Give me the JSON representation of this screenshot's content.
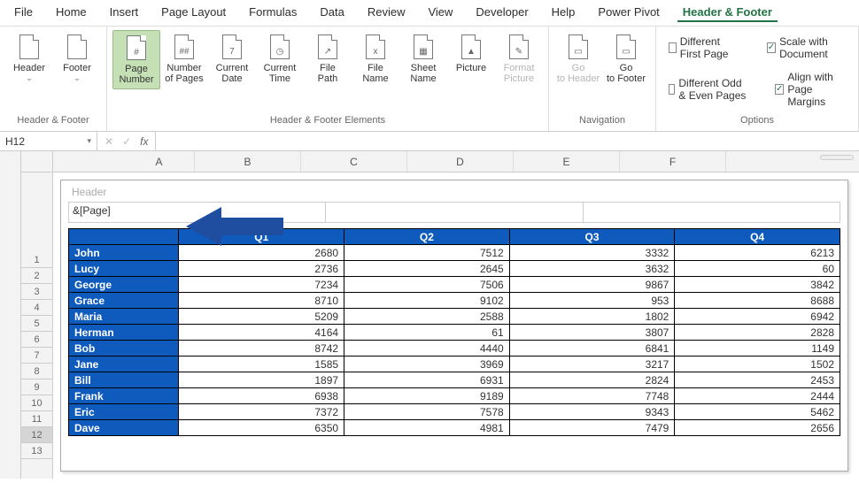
{
  "tabs": [
    "File",
    "Home",
    "Insert",
    "Page Layout",
    "Formulas",
    "Data",
    "Review",
    "View",
    "Developer",
    "Help",
    "Power Pivot",
    "Header & Footer"
  ],
  "active_tab_index": 11,
  "groups": {
    "hf": {
      "label": "Header & Footer",
      "buttons": [
        {
          "label": "Header",
          "caret": true,
          "glyph": ""
        },
        {
          "label": "Footer",
          "caret": true,
          "glyph": ""
        }
      ]
    },
    "elements": {
      "label": "Header & Footer Elements",
      "buttons": [
        {
          "label": "Page Number",
          "glyph": "#",
          "sel": true
        },
        {
          "label": "Number of Pages",
          "glyph": "##"
        },
        {
          "label": "Current Date",
          "glyph": "7"
        },
        {
          "label": "Current Time",
          "glyph": "◷"
        },
        {
          "label": "File Path",
          "glyph": "↗"
        },
        {
          "label": "File Name",
          "glyph": "x"
        },
        {
          "label": "Sheet Name",
          "glyph": "▦"
        },
        {
          "label": "Picture",
          "glyph": "▲"
        },
        {
          "label": "Format Picture",
          "glyph": "✎",
          "disabled": true
        }
      ]
    },
    "nav": {
      "label": "Navigation",
      "buttons": [
        {
          "label": "Go to Header",
          "glyph": "▭",
          "disabled": true
        },
        {
          "label": "Go to Footer",
          "glyph": "▭"
        }
      ]
    }
  },
  "options": {
    "label": "Options",
    "items": [
      {
        "label": "Different First Page",
        "checked": false
      },
      {
        "label": "Scale with Document",
        "checked": true
      },
      {
        "label": "Different Odd & Even Pages",
        "checked": false
      },
      {
        "label": "Align with Page Margins",
        "checked": true
      }
    ]
  },
  "cell_ref": "H12",
  "fx": "fx",
  "header_label": "Header",
  "header_value": "&[Page]",
  "columns": [
    "A",
    "B",
    "C",
    "D",
    "E",
    "F"
  ],
  "rows": [
    1,
    2,
    3,
    4,
    5,
    6,
    7,
    8,
    9,
    10,
    11,
    12,
    13
  ],
  "selected_row": 12,
  "chart_data": {
    "type": "table",
    "headers": [
      "",
      "Q1",
      "Q2",
      "Q3",
      "Q4"
    ],
    "data": [
      {
        "name": "John",
        "Q1": 2680,
        "Q2": 7512,
        "Q3": 3332,
        "Q4": 6213
      },
      {
        "name": "Lucy",
        "Q1": 2736,
        "Q2": 2645,
        "Q3": 3632,
        "Q4": 60
      },
      {
        "name": "George",
        "Q1": 7234,
        "Q2": 7506,
        "Q3": 9867,
        "Q4": 3842
      },
      {
        "name": "Grace",
        "Q1": 8710,
        "Q2": 9102,
        "Q3": 953,
        "Q4": 8688
      },
      {
        "name": "Maria",
        "Q1": 5209,
        "Q2": 2588,
        "Q3": 1802,
        "Q4": 6942
      },
      {
        "name": "Herman",
        "Q1": 4164,
        "Q2": 61,
        "Q3": 3807,
        "Q4": 2828
      },
      {
        "name": "Bob",
        "Q1": 8742,
        "Q2": 4440,
        "Q3": 6841,
        "Q4": 1149
      },
      {
        "name": "Jane",
        "Q1": 1585,
        "Q2": 3969,
        "Q3": 3217,
        "Q4": 1502
      },
      {
        "name": "Bill",
        "Q1": 1897,
        "Q2": 6931,
        "Q3": 2824,
        "Q4": 2453
      },
      {
        "name": "Frank",
        "Q1": 6938,
        "Q2": 9189,
        "Q3": 7748,
        "Q4": 2444
      },
      {
        "name": "Eric",
        "Q1": 7372,
        "Q2": 7578,
        "Q3": 9343,
        "Q4": 5462
      },
      {
        "name": "Dave",
        "Q1": 6350,
        "Q2": 4981,
        "Q3": 7479,
        "Q4": 2656
      }
    ]
  }
}
